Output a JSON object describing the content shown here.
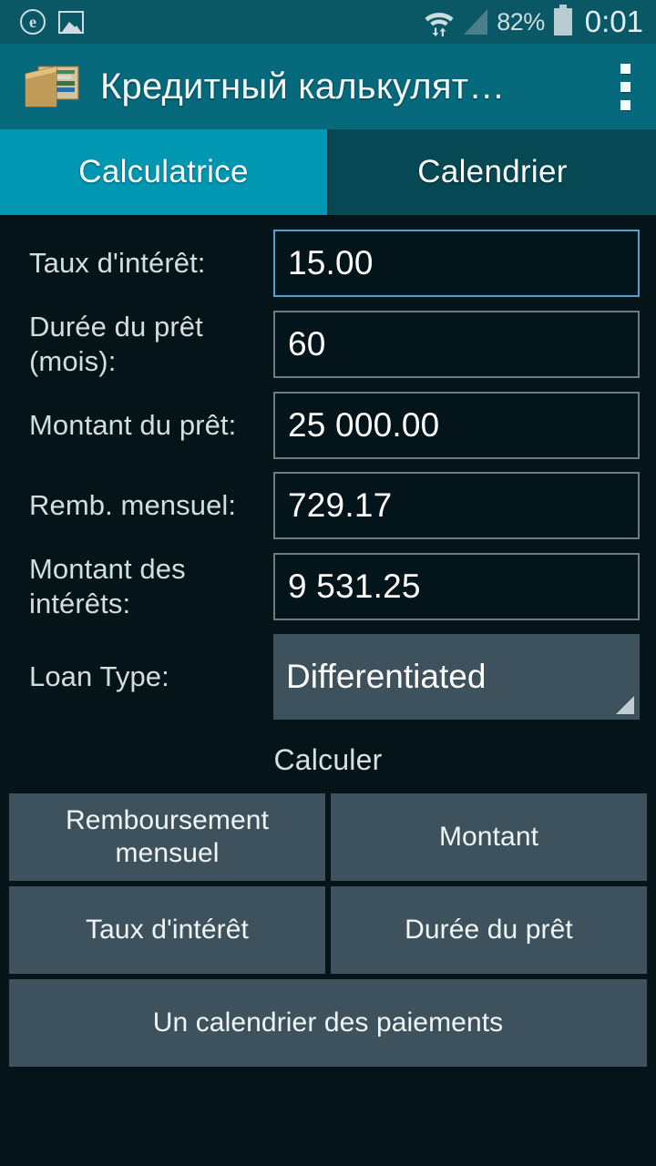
{
  "statusbar": {
    "left_icons": [
      {
        "name": "e-badge-icon",
        "glyph": "e"
      },
      {
        "name": "image-icon",
        "glyph": ""
      }
    ],
    "wifi_icon": "wifi-icon",
    "signal_icon": "cellular-signal-icon",
    "battery_percent": "82%",
    "battery_icon": "battery-icon",
    "time": "0:01"
  },
  "actionbar": {
    "app_icon": "wallet-icon",
    "title": "Кредитный калькулят…",
    "overflow_icon": "overflow-menu-icon"
  },
  "tabs": [
    {
      "label": "Calculatrice",
      "active": true
    },
    {
      "label": "Calendrier",
      "active": false
    }
  ],
  "form": {
    "fields": [
      {
        "label": "Taux d'intérêt:",
        "value": "15.00",
        "focused": true,
        "type": "text"
      },
      {
        "label": "Durée du prêt (mois):",
        "value": "60",
        "focused": false,
        "type": "text"
      },
      {
        "label": "Montant du prêt:",
        "value": "25 000.00",
        "focused": false,
        "type": "text"
      },
      {
        "label": "Remb. mensuel:",
        "value": "729.17",
        "focused": false,
        "type": "text"
      },
      {
        "label": "Montant des intérêts:",
        "value": "9 531.25",
        "focused": false,
        "type": "text"
      },
      {
        "label": "Loan Type:",
        "value": "Differentiated",
        "focused": false,
        "type": "spinner"
      }
    ]
  },
  "calculate_section": {
    "heading": "Calculer",
    "buttons": [
      "Remboursement mensuel",
      "Montant",
      "Taux d'intérêt",
      "Durée du prêt",
      "Un calendrier des paiements"
    ]
  },
  "colors": {
    "statusbar_bg": "#0a5866",
    "actionbar_bg": "#06697c",
    "tab_active_bg": "#0097b2",
    "tab_inactive_bg": "#064853",
    "page_bg": "#041419",
    "field_border": "#6d7b82",
    "field_border_focused": "#4da3d4",
    "button_bg": "#3d525c",
    "text_primary": "#ffffff",
    "label_text": "#d3dee1"
  }
}
